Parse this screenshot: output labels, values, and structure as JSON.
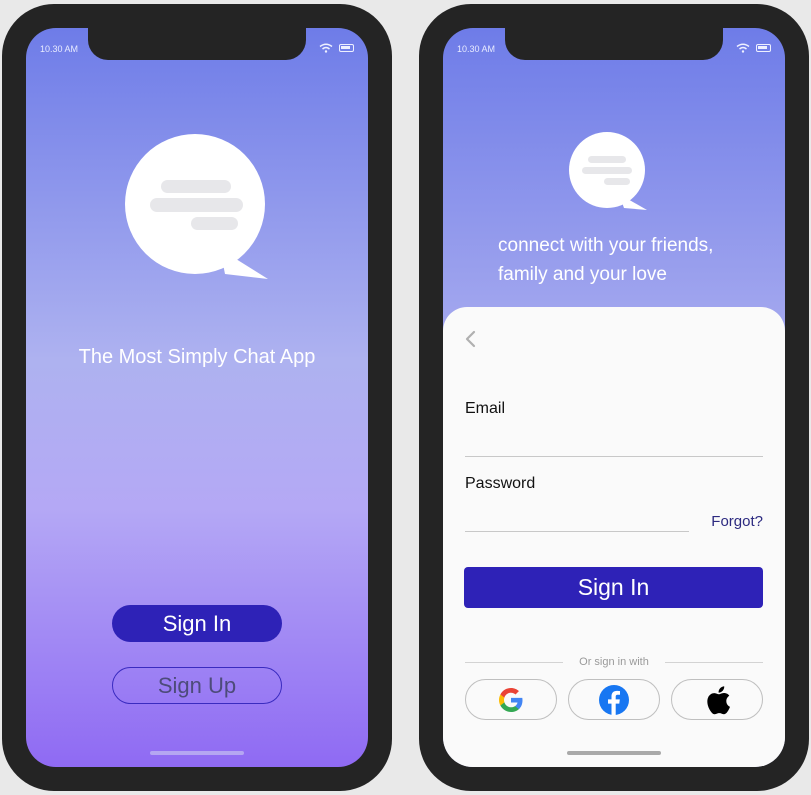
{
  "screen1": {
    "status_time": "10.30 AM",
    "tagline": "The Most Simply Chat App",
    "sign_in_label": "Sign In",
    "sign_up_label": "Sign Up"
  },
  "screen2": {
    "status_time": "10.30 AM",
    "tagline_line1": "connect with your friends,",
    "tagline_line2": "family and your love",
    "email_label": "Email",
    "email_value": "",
    "password_label": "Password",
    "password_value": "",
    "forgot_label": "Forgot?",
    "sign_in_label": "Sign In",
    "or_label": "Or sign in with",
    "social_icons": [
      "google-icon",
      "facebook-icon",
      "apple-icon"
    ]
  },
  "colors": {
    "primary": "#2e22b7",
    "gradient_top": "#6e7ce8",
    "gradient_bottom": "#8f6af3",
    "sheet": "#fafafa"
  }
}
